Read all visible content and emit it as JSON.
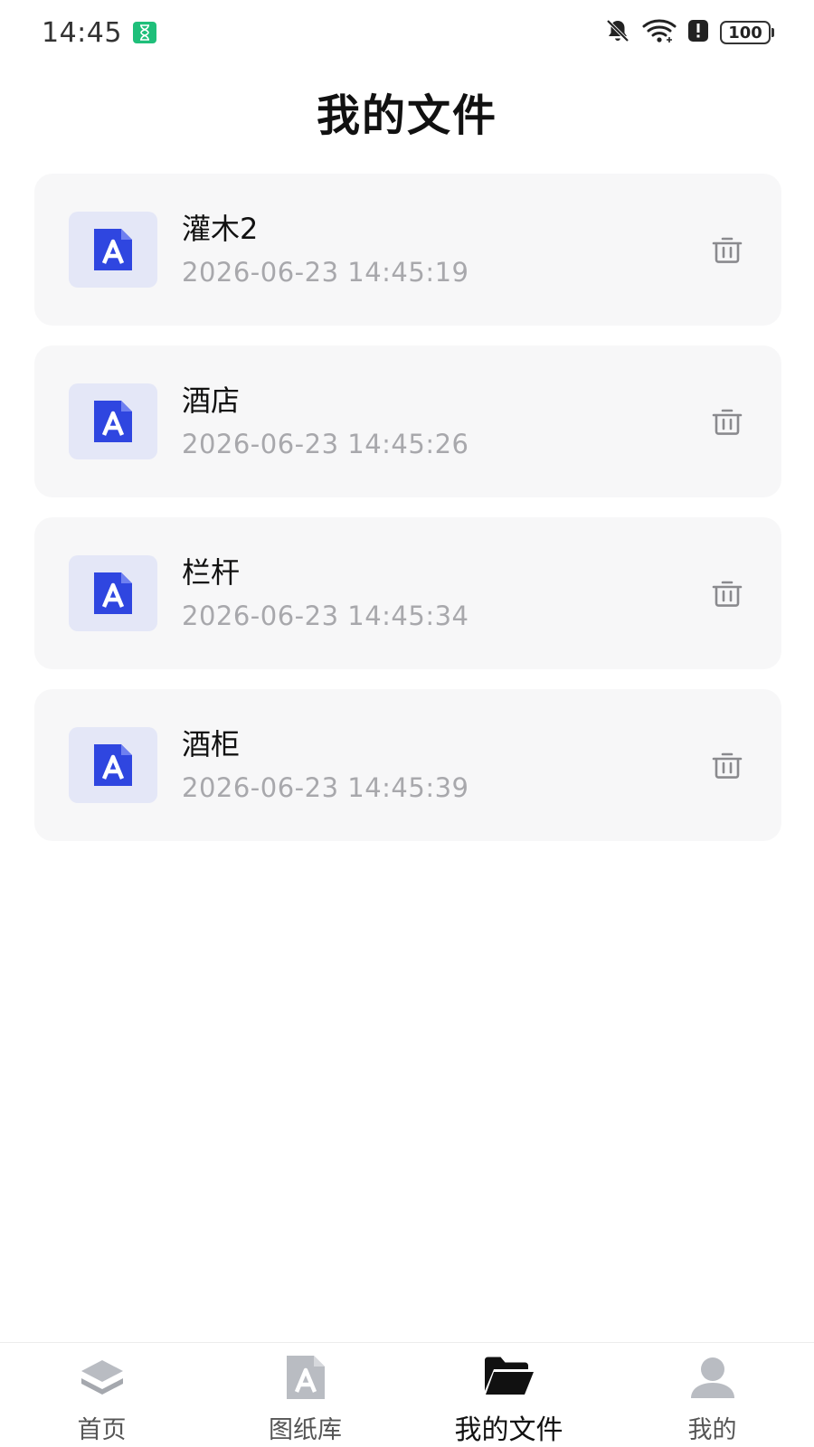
{
  "status_bar": {
    "time": "14:45",
    "battery": "100"
  },
  "header": {
    "title": "我的文件"
  },
  "files": [
    {
      "name": "灌木2",
      "date": "2026-06-23 14:45:19"
    },
    {
      "name": "酒店",
      "date": "2026-06-23 14:45:26"
    },
    {
      "name": "栏杆",
      "date": "2026-06-23 14:45:34"
    },
    {
      "name": "酒柜",
      "date": "2026-06-23 14:45:39"
    }
  ],
  "bottom_nav": {
    "items": [
      {
        "label": "首页",
        "icon": "layers-icon"
      },
      {
        "label": "图纸库",
        "icon": "drawing-doc-icon"
      },
      {
        "label": "我的文件",
        "icon": "folder-open-icon",
        "active": true
      },
      {
        "label": "我的",
        "icon": "user-icon"
      }
    ]
  },
  "colors": {
    "accent": "#2f46e0",
    "thumb_bg": "#e4e7f7",
    "card_bg": "#f7f7f8",
    "muted_text": "#a8a8ac",
    "status_green": "#1fbf7a"
  }
}
